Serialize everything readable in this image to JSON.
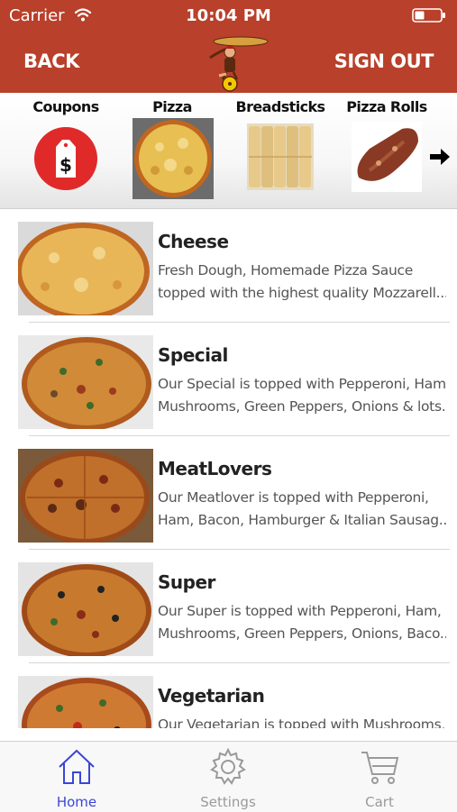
{
  "status": {
    "carrier": "Carrier",
    "time": "10:04 PM"
  },
  "nav": {
    "back_label": "BACK",
    "signout_label": "SIGN OUT",
    "logo_icon": "pizza-delivery-logo"
  },
  "categories": [
    {
      "label": "Coupons",
      "icon": "price-tag-dollar-icon"
    },
    {
      "label": "Pizza",
      "icon": "pizza-thumbnail"
    },
    {
      "label": "Breadsticks",
      "icon": "breadsticks-thumbnail"
    },
    {
      "label": "Pizza Rolls",
      "icon": "pizza-roll-thumbnail"
    }
  ],
  "products": [
    {
      "title": "Cheese",
      "desc1": "Fresh Dough, Homemade Pizza Sauce",
      "desc2": "topped with the highest quality Mozzarell..."
    },
    {
      "title": "Special",
      "desc1": "Our Special is topped with Pepperoni, Ham,",
      "desc2": "Mushrooms, Green Peppers, Onions & lots..."
    },
    {
      "title": "MeatLovers",
      "desc1": "Our Meatlover is topped with Pepperoni,",
      "desc2": "Ham, Bacon, Hamburger & Italian Sausag..."
    },
    {
      "title": "Super",
      "desc1": "Our Super is topped with Pepperoni, Ham,",
      "desc2": "Mushrooms, Green Peppers, Onions, Baco..."
    },
    {
      "title": "Vegetarian",
      "desc1": "Our Vegetarian is topped with Mushrooms,",
      "desc2": ""
    }
  ],
  "tabs": [
    {
      "label": "Home",
      "icon": "home-icon",
      "active": true
    },
    {
      "label": "Settings",
      "icon": "gear-icon",
      "active": false
    },
    {
      "label": "Cart",
      "icon": "cart-icon",
      "active": false
    }
  ],
  "colors": {
    "brand": "#b9402a",
    "tab_active": "#3a46d6",
    "tab_inactive": "#9a9a9a"
  }
}
